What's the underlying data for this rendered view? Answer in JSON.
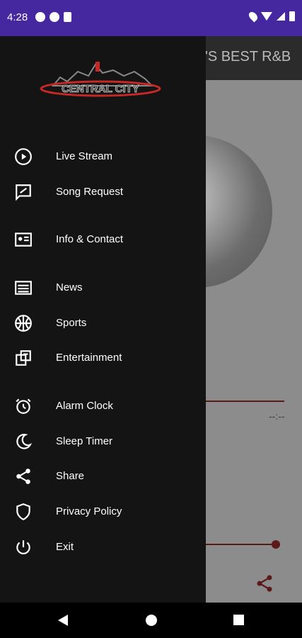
{
  "status_bar": {
    "time": "4:28"
  },
  "background_app": {
    "title": "'S BEST R&B",
    "elapsed": "--:--",
    "share_icon": "share-icon"
  },
  "drawer": {
    "logo_text": "CENTRAL CITY",
    "items": [
      {
        "label": "Live Stream",
        "icon": "play-circle-icon"
      },
      {
        "label": "Song Request",
        "icon": "request-icon"
      },
      {
        "label": "Info & Contact",
        "icon": "contact-card-icon"
      },
      {
        "label": "News",
        "icon": "news-icon"
      },
      {
        "label": "Sports",
        "icon": "basketball-icon"
      },
      {
        "label": "Entertainment",
        "icon": "entertainment-icon"
      },
      {
        "label": "Alarm Clock",
        "icon": "alarm-icon"
      },
      {
        "label": "Sleep Timer",
        "icon": "moon-icon"
      },
      {
        "label": "Share",
        "icon": "share-icon"
      },
      {
        "label": "Privacy Policy",
        "icon": "shield-icon"
      },
      {
        "label": "Exit",
        "icon": "power-icon"
      }
    ]
  }
}
